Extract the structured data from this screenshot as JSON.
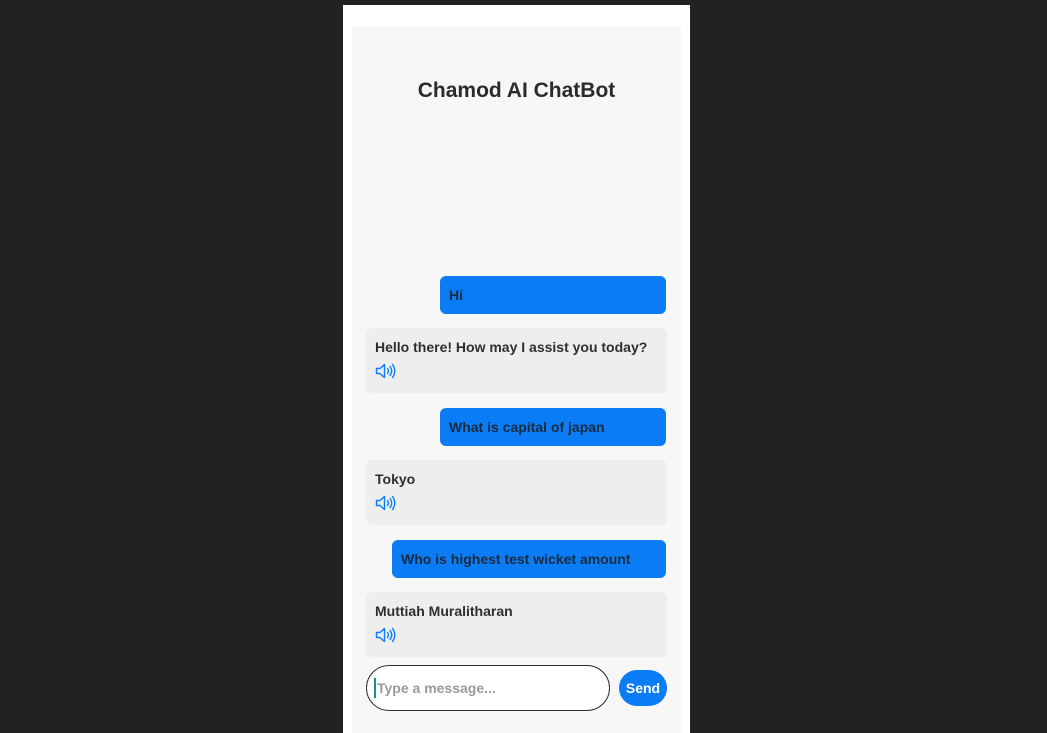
{
  "app": {
    "title": "Chamod AI ChatBot"
  },
  "messages": [
    {
      "role": "user",
      "text": "Hi"
    },
    {
      "role": "bot",
      "text": "Hello there! How may I assist you today?",
      "icon": "speaker-icon"
    },
    {
      "role": "user",
      "text": "What is capital of japan"
    },
    {
      "role": "bot",
      "text": "Tokyo",
      "icon": "speaker-icon"
    },
    {
      "role": "user",
      "text": "Who is highest test wicket amount"
    },
    {
      "role": "bot",
      "text": "Muttiah Muralitharan",
      "icon": "speaker-icon"
    }
  ],
  "composer": {
    "placeholder": "Type a message...",
    "value": "",
    "send_label": "Send"
  },
  "colors": {
    "accent": "#0a7cf5",
    "background": "#222222",
    "card": "#f7f7f7",
    "bot_bubble": "#eeeeee"
  }
}
